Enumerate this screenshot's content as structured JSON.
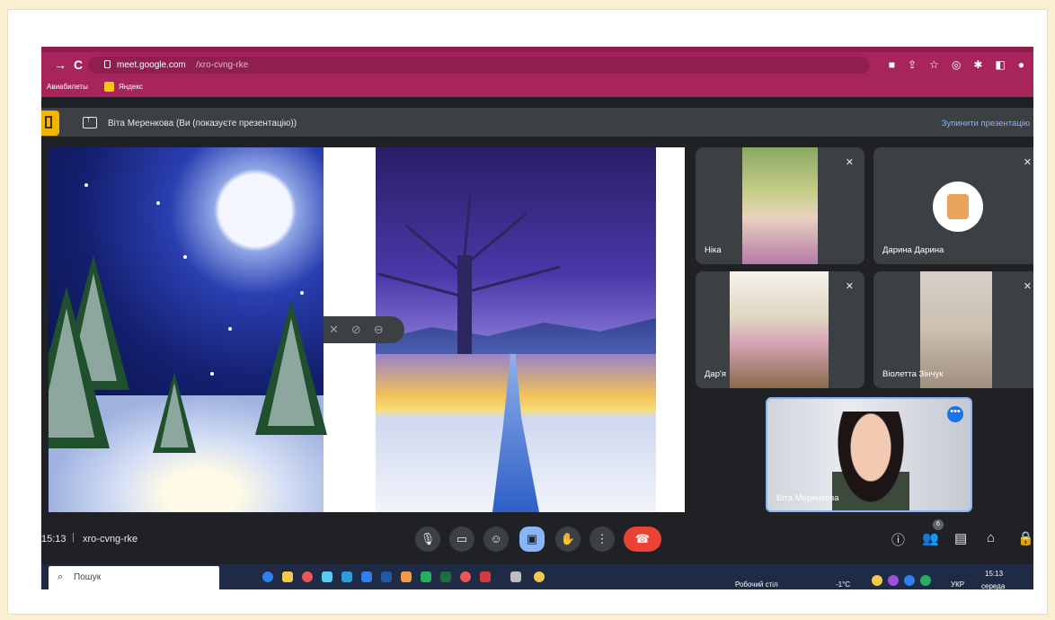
{
  "browser": {
    "url_host": "meet.google.com",
    "url_path": "/xro-cvng-rke",
    "bookmarks": [
      "Авиабилеты",
      "Яндекс"
    ]
  },
  "banner": {
    "presenter_text": "Віта Меренкова (Ви (показуєте презентацію))",
    "stop_label": "Зупинити презентацію"
  },
  "participants": [
    {
      "name": "Ніка"
    },
    {
      "name": "Дарина Дарина"
    },
    {
      "name": "Дар'я"
    },
    {
      "name": "Віолетта Зінчук"
    }
  ],
  "self": {
    "name": "Віта Меренкова"
  },
  "meeting": {
    "time": "15:13",
    "separator": "|",
    "code": "xro-cvng-rke",
    "participant_count": "6"
  },
  "taskbar": {
    "search_placeholder": "Пошук",
    "desktop_label": "Робочий стіл",
    "temperature": "-1°C",
    "language": "УКР",
    "time": "15:13",
    "date": "середа"
  },
  "colors": {
    "chrome": "#a8255c",
    "meet_bg": "#202124",
    "tile_bg": "#3c4043",
    "accent": "#8ab4f8",
    "end_call": "#ea4335"
  }
}
